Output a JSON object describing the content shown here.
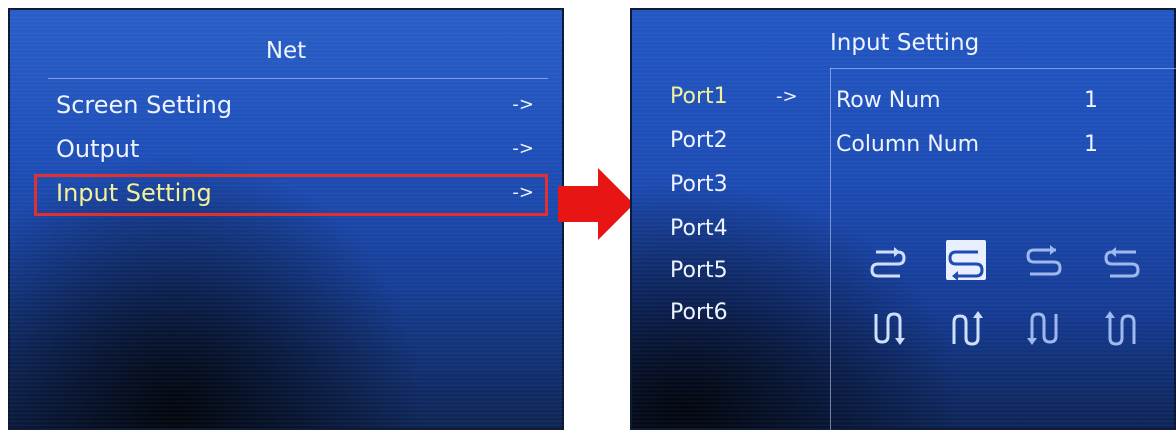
{
  "net_screen": {
    "title": "Net",
    "items": [
      {
        "label": "Screen Setting",
        "arrow": "->"
      },
      {
        "label": "Output",
        "arrow": "->"
      },
      {
        "label": "Input Setting",
        "arrow": "->"
      }
    ]
  },
  "input_screen": {
    "title": "Input Setting",
    "ports": [
      "Port1",
      "Port2",
      "Port3",
      "Port4",
      "Port5",
      "Port6"
    ],
    "port_arrow": "->",
    "row_num": {
      "label": "Row Num",
      "value": "1"
    },
    "column_num": {
      "label": "Column Num",
      "value": "1"
    },
    "patterns_row1": [
      "horizontal-serpentine-right-icon",
      "horizontal-serpentine-left-selected-icon",
      "horizontal-serpentine-up-icon",
      "horizontal-serpentine-left-icon"
    ],
    "patterns_row2": [
      "vertical-serpentine-down-icon",
      "vertical-serpentine-up-icon",
      "vertical-serpentine-reverse-down-icon",
      "vertical-serpentine-reverse-up-icon"
    ]
  },
  "colors": {
    "highlight_text": "#f3f09a",
    "selection_box": "#e23030",
    "flow_arrow": "#e81515"
  }
}
